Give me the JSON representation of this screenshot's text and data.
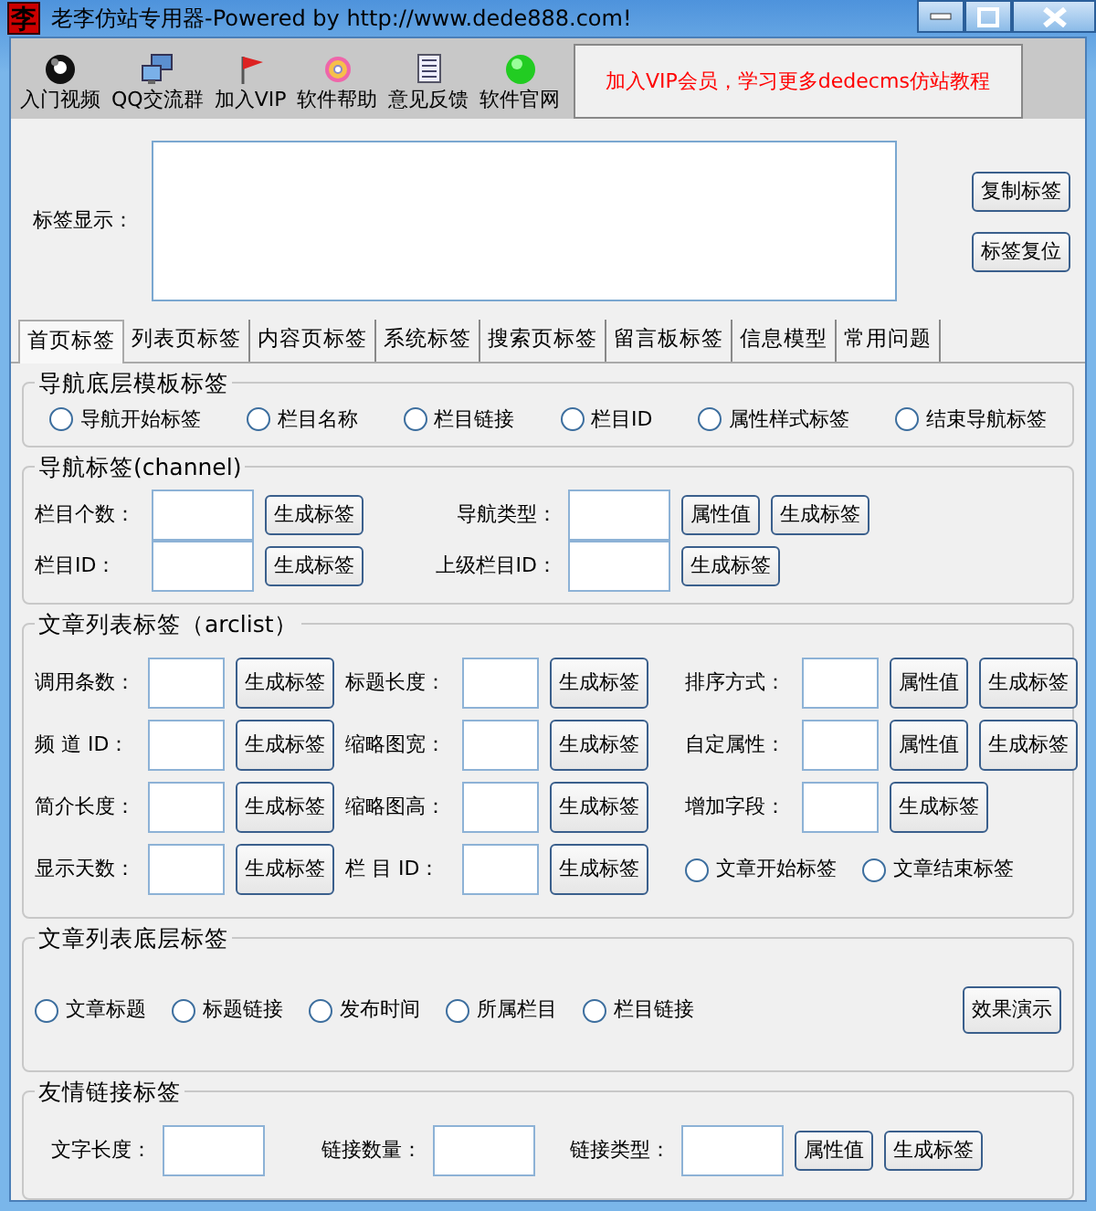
{
  "window": {
    "icon_char": "李",
    "title": "老李仿站专用器-Powered by http://www.dede888.com!"
  },
  "toolbar": [
    {
      "label": "入门视频"
    },
    {
      "label": "QQ交流群"
    },
    {
      "label": "加入VIP"
    },
    {
      "label": "软件帮助"
    },
    {
      "label": "意见反馈"
    },
    {
      "label": "软件官网"
    }
  ],
  "promo": "加入VIP会员，学习更多dedecms仿站教程",
  "tag_display": {
    "label": "标签显示：",
    "buttons": [
      "复制标签",
      "标签复位"
    ]
  },
  "tabs": [
    {
      "label": "首页标签",
      "selected": true
    },
    {
      "label": "列表页标签",
      "selected": false
    },
    {
      "label": "内容页标签",
      "selected": false
    },
    {
      "label": "系统标签",
      "selected": false
    },
    {
      "label": "搜索页标签",
      "selected": false
    },
    {
      "label": "留言板标签",
      "selected": false
    },
    {
      "label": "信息模型",
      "selected": false
    },
    {
      "label": "常用问题",
      "selected": false
    }
  ],
  "groups": [
    {
      "title": "导航底层模板标签",
      "rows": [
        [
          {
            "kind": "radio",
            "label": "导航开始标签",
            "selected": false
          },
          {
            "kind": "radio",
            "label": "栏目名称",
            "selected": false
          },
          {
            "kind": "radio",
            "label": "栏目链接",
            "selected": false
          },
          {
            "kind": "radio",
            "label": "栏目ID",
            "selected": false
          },
          {
            "kind": "radio",
            "label": "属性样式标签",
            "selected": false
          },
          {
            "kind": "radio",
            "label": "结束导航标签",
            "selected": false
          }
        ]
      ]
    },
    {
      "title": "导航标签(channel)",
      "rows": [
        [
          {
            "kind": "field",
            "label": "栏目个数：",
            "buttons": [
              "生成标签"
            ]
          },
          {
            "kind": "field",
            "label": "导航类型：",
            "buttons": [
              "属性值",
              "生成标签"
            ]
          }
        ],
        [
          {
            "kind": "field",
            "label": "栏目ID：",
            "buttons": [
              "生成标签"
            ]
          },
          {
            "kind": "field",
            "label": "上级栏目ID：",
            "buttons": [
              "生成标签"
            ]
          }
        ]
      ]
    },
    {
      "title": "文章列表标签（arclist）",
      "rows": [
        [
          {
            "kind": "field",
            "label": "调用条数：",
            "buttons": [
              "生成标签"
            ]
          },
          {
            "kind": "field",
            "label": "标题长度：",
            "buttons": [
              "生成标签"
            ]
          },
          {
            "kind": "field",
            "label": "排序方式：",
            "buttons": [
              "属性值",
              "生成标签"
            ]
          }
        ],
        [
          {
            "kind": "field",
            "label": "频 道 ID：",
            "buttons": [
              "生成标签"
            ]
          },
          {
            "kind": "field",
            "label": "缩略图宽：",
            "buttons": [
              "生成标签"
            ]
          },
          {
            "kind": "field",
            "label": "自定属性：",
            "buttons": [
              "属性值",
              "生成标签"
            ]
          }
        ],
        [
          {
            "kind": "field",
            "label": "简介长度：",
            "buttons": [
              "生成标签"
            ]
          },
          {
            "kind": "field",
            "label": "缩略图高：",
            "buttons": [
              "生成标签"
            ]
          },
          {
            "kind": "field",
            "label": "增加字段：",
            "buttons": [
              "生成标签"
            ]
          }
        ],
        [
          {
            "kind": "field",
            "label": "显示天数：",
            "buttons": [
              "生成标签"
            ]
          },
          {
            "kind": "field",
            "label": "栏 目 ID：",
            "buttons": [
              "生成标签"
            ]
          },
          {
            "kind": "radio",
            "label": "文章开始标签",
            "selected": false
          },
          {
            "kind": "radio",
            "label": "文章结束标签",
            "selected": false
          }
        ]
      ]
    },
    {
      "title": "文章列表底层标签",
      "rows": [
        [
          {
            "kind": "radio",
            "label": "文章标题",
            "selected": false
          },
          {
            "kind": "radio",
            "label": "标题链接",
            "selected": false
          },
          {
            "kind": "radio",
            "label": "发布时间",
            "selected": false
          },
          {
            "kind": "radio",
            "label": "所属栏目",
            "selected": false
          },
          {
            "kind": "radio",
            "label": "栏目链接",
            "selected": false
          },
          {
            "kind": "button",
            "label": "效果演示"
          }
        ]
      ]
    },
    {
      "title": "友情链接标签",
      "rows": [
        [
          {
            "kind": "field",
            "label": "文字长度："
          },
          {
            "kind": "field",
            "label": "链接数量："
          },
          {
            "kind": "field",
            "label": "链接类型：",
            "buttons": [
              "属性值",
              "生成标签"
            ]
          }
        ]
      ]
    }
  ]
}
